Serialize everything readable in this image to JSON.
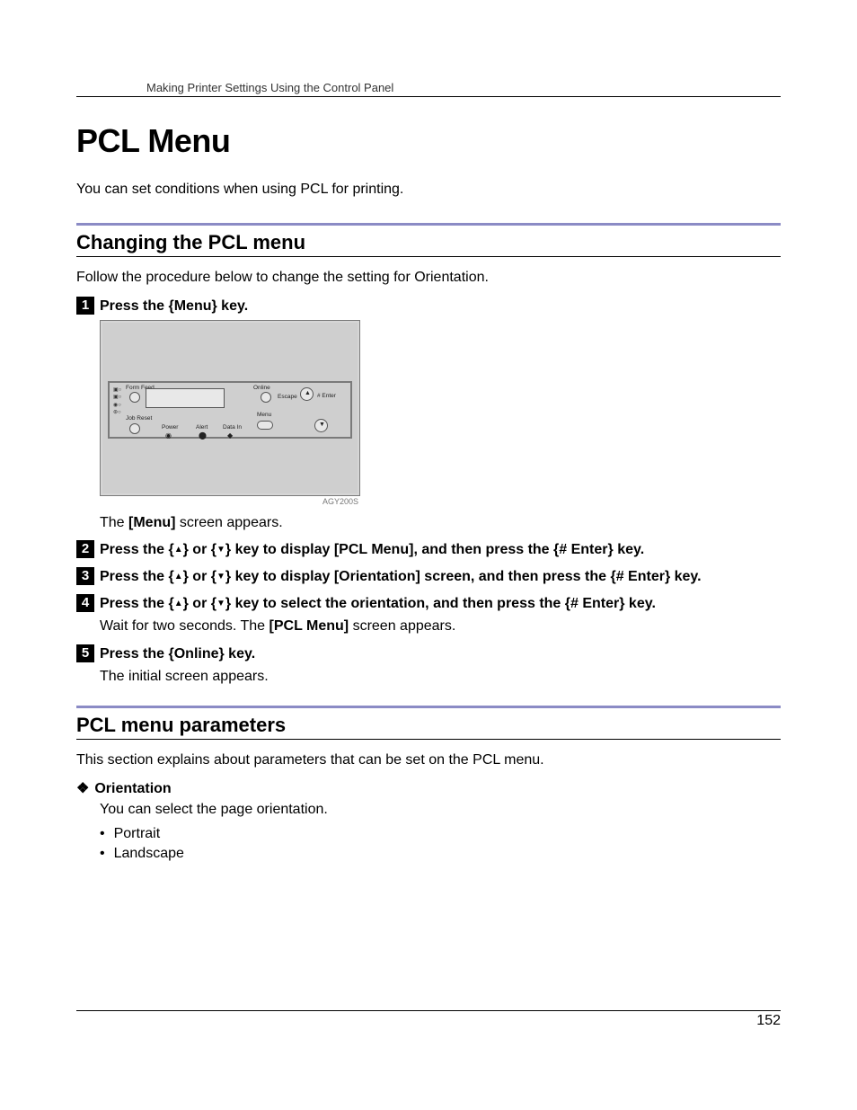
{
  "running_head": "Making Printer Settings Using the Control Panel",
  "title": "PCL Menu",
  "intro": "You can set conditions when using PCL for printing.",
  "section1": {
    "heading": "Changing the PCL menu",
    "lead": "Follow the procedure below to change the setting for Orientation."
  },
  "panel": {
    "caption": "AGY200S",
    "labels": {
      "form_feed": "Form Feed",
      "job_reset": "Job Reset",
      "power": "Power",
      "alert": "Alert",
      "data_in": "Data In",
      "online": "Online",
      "escape": "Escape",
      "enter": "# Enter",
      "menu": "Menu"
    }
  },
  "steps": {
    "s1": {
      "num": "1",
      "a": "Press the ",
      "b": "Menu",
      "c": " key."
    },
    "s1_body": "The [Menu] screen appears.",
    "s2": {
      "num": "2",
      "a": "Press the ",
      "mid": " key to display ",
      "target": "[PCL Menu]",
      "tail": ", and then press the ",
      "enter": "# Enter",
      "end": " key."
    },
    "s3": {
      "num": "3",
      "a": "Press the ",
      "mid": " key to display ",
      "target": "[Orientation]",
      "tail": " screen, and then press the ",
      "enter": "# Enter",
      "end": " key."
    },
    "s4": {
      "num": "4",
      "a": "Press the ",
      "mid": " key to select the orientation, and then press the ",
      "enter": "# Enter",
      "end": " key."
    },
    "s4_body_a": "Wait for two seconds. The ",
    "s4_body_b": "[PCL Menu]",
    "s4_body_c": " screen appears.",
    "s5": {
      "num": "5",
      "a": "Press the ",
      "b": "Online",
      "c": " key."
    },
    "s5_body": "The initial screen appears."
  },
  "keys": {
    "open": "{",
    "close": "}",
    "up": "▲",
    "down": "▼",
    "or": " or "
  },
  "section2": {
    "heading": "PCL menu parameters",
    "lead": "This section explains about parameters that can be set on the PCL menu."
  },
  "param": {
    "name": "Orientation",
    "desc": "You can select the page orientation.",
    "opts": [
      "Portrait",
      "Landscape"
    ]
  },
  "page_number": "152"
}
